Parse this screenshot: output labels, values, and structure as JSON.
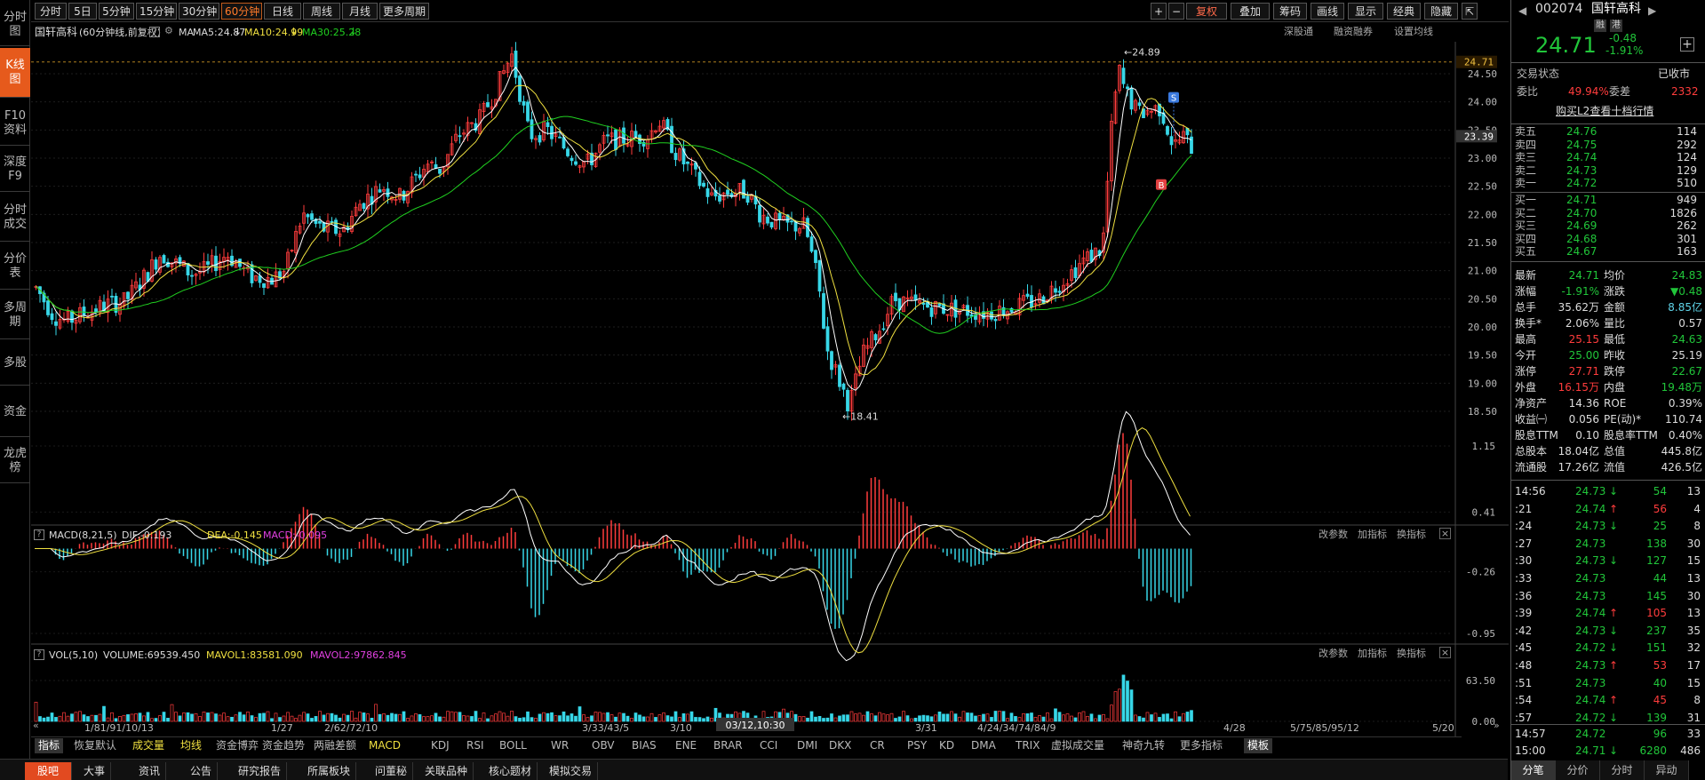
{
  "left_tabs": [
    "分时图",
    "K线图",
    "F10资料",
    "深度F9",
    "分时成交",
    "分价表",
    "多周期",
    "多股",
    "资金",
    "龙虎榜"
  ],
  "left_active": 1,
  "toolbar": {
    "periods": [
      "分时",
      "5日",
      "5分钟",
      "15分钟",
      "30分钟",
      "60分钟",
      "日线",
      "周线",
      "月线",
      "更多周期"
    ],
    "active_period": "60分钟",
    "right_buttons": [
      "+",
      "−",
      "复权",
      "叠加",
      "筹码",
      "画线",
      "显示",
      "经典",
      "隐藏"
    ],
    "right_icons": [
      "collapse-icon"
    ]
  },
  "chart_title": {
    "name": "国轩高科",
    "sub": "(60分钟线,前复权)",
    "ma_label": "MA",
    "ma5": "MA5:24.87",
    "ma10": "MA10:24.99",
    "ma30": "MA30:25.28",
    "links": [
      "深股通",
      "融资融券",
      "设置均线"
    ]
  },
  "price_axis": {
    "ticks": [
      "24.50",
      "24.00",
      "23.50",
      "23.00",
      "22.50",
      "22.00",
      "21.50",
      "21.00",
      "20.50",
      "20.00",
      "19.50",
      "19.00",
      "18.50"
    ],
    "current": "23.39",
    "high_tag": "24.71"
  },
  "annotations": {
    "high": "24.89",
    "low": "18.41",
    "buy_marker": "B",
    "sell_marker": "S"
  },
  "macd": {
    "title": "MACD(8,21,5)",
    "dif": "DIF:-0.193",
    "dea": "DEA:-0.145",
    "macd": "MACD:-0.095",
    "ticks": [
      "1.15",
      "0.41",
      "-0.26",
      "-0.95"
    ],
    "actions": [
      "改参数",
      "加指标",
      "换指标"
    ]
  },
  "vol": {
    "title": "VOL(5,10)",
    "volume": "VOLUME:69539.450",
    "mavol1": "MAVOL1:83581.090",
    "mavol2": "MAVOL2:97862.845",
    "ticks": [
      "63.50",
      "0.00"
    ],
    "actions": [
      "改参数",
      "加指标",
      "换指标"
    ]
  },
  "x_axis": {
    "labels": [
      "1/81/91/10/13",
      "1/27",
      "2/62/72/10",
      "3/33/43/5",
      "3/10",
      "3/31",
      "4/24/34/74/84/9",
      "4/28",
      "5/75/85/95/12",
      "5/20"
    ],
    "cursor": "03/12,10:30"
  },
  "indicator_bar": [
    "指标",
    "恢复默认",
    "成交量",
    "均线",
    "资金博弈",
    "资金趋势",
    "两融差额",
    "MACD",
    "KDJ",
    "RSI",
    "BOLL",
    "WR",
    "OBV",
    "BIAS",
    "ENE",
    "BRAR",
    "CCI",
    "DMI",
    "DKX",
    "CR",
    "PSY",
    "KD",
    "DMA",
    "TRIX",
    "虚拟成交量",
    "神奇九转",
    "更多指标",
    "模板"
  ],
  "bottom_nav": [
    "股吧",
    "大事",
    "资讯",
    "公告",
    "研究报告",
    "所属板块",
    "问董秘",
    "关联品种",
    "核心题材",
    "模拟交易"
  ],
  "quote": {
    "code": "002074",
    "name": "国轩高科",
    "tags": [
      "融",
      "港"
    ],
    "price": "24.71",
    "change": "-0.48",
    "pct": "-1.91%",
    "status_label": "交易状态",
    "status": "已收市",
    "weibi_label": "委比",
    "weibi": "49.94%",
    "weicha_label": "委差",
    "weicha": "2332",
    "l2": "购买L2查看十档行情",
    "asks": [
      [
        "卖五",
        "24.76",
        "114"
      ],
      [
        "卖四",
        "24.75",
        "292"
      ],
      [
        "卖三",
        "24.74",
        "124"
      ],
      [
        "卖二",
        "24.73",
        "129"
      ],
      [
        "卖一",
        "24.72",
        "510"
      ]
    ],
    "bids": [
      [
        "买一",
        "24.71",
        "949"
      ],
      [
        "买二",
        "24.70",
        "1826"
      ],
      [
        "买三",
        "24.69",
        "262"
      ],
      [
        "买四",
        "24.68",
        "301"
      ],
      [
        "买五",
        "24.67",
        "163"
      ]
    ],
    "stats": [
      [
        "最新",
        "24.71",
        "均价",
        "24.83"
      ],
      [
        "涨幅",
        "-1.91%",
        "涨跌",
        "▼0.48"
      ],
      [
        "总手",
        "35.62万",
        "金额",
        "8.85亿"
      ],
      [
        "换手*",
        "2.06%",
        "量比",
        "0.57"
      ],
      [
        "最高",
        "25.15",
        "最低",
        "24.63"
      ],
      [
        "今开",
        "25.00",
        "昨收",
        "25.19"
      ],
      [
        "涨停",
        "27.71",
        "跌停",
        "22.67"
      ],
      [
        "外盘",
        "16.15万",
        "内盘",
        "19.48万"
      ],
      [
        "净资产",
        "14.36",
        "ROE",
        "0.39%"
      ],
      [
        "收益㈠",
        "0.056",
        "PE(动)*",
        "110.74"
      ],
      [
        "股息TTM",
        "0.10",
        "股息率TTM",
        "0.40%"
      ],
      [
        "总股本",
        "18.04亿",
        "总值",
        "445.8亿"
      ],
      [
        "流通股",
        "17.26亿",
        "流值",
        "426.5亿"
      ]
    ],
    "ticks": [
      [
        "14:56",
        "24.73",
        "↓",
        "54",
        "13"
      ],
      [
        ":21",
        "24.74",
        "↑",
        "56",
        "4"
      ],
      [
        ":24",
        "24.73",
        "↓",
        "25",
        "8"
      ],
      [
        ":27",
        "24.73",
        "",
        "138",
        "30"
      ],
      [
        ":30",
        "24.73",
        "↓",
        "127",
        "15"
      ],
      [
        ":33",
        "24.73",
        "",
        "44",
        "13"
      ],
      [
        ":36",
        "24.73",
        "",
        "145",
        "30"
      ],
      [
        ":39",
        "24.74",
        "↑",
        "105",
        "13"
      ],
      [
        ":42",
        "24.73",
        "↓",
        "237",
        "35"
      ],
      [
        ":45",
        "24.72",
        "↓",
        "151",
        "32"
      ],
      [
        ":48",
        "24.73",
        "↑",
        "53",
        "17"
      ],
      [
        ":51",
        "24.73",
        "",
        "40",
        "15"
      ],
      [
        ":54",
        "24.74",
        "↑",
        "45",
        "8"
      ],
      [
        ":57",
        "24.72",
        "↓",
        "139",
        "31"
      ],
      [
        "14:57",
        "24.72",
        "",
        "96",
        "33"
      ],
      [
        "15:00",
        "24.71",
        "↓",
        "6280",
        "486"
      ]
    ],
    "bottom_tabs": [
      "分笔",
      "分价",
      "分时",
      "异动"
    ]
  },
  "colors": {
    "up": "#ff3c3c",
    "down": "#21c63a",
    "ma5": "#ffffff",
    "ma10": "#f0e040",
    "ma30": "#20d020",
    "accent": "#e65a1c"
  }
}
